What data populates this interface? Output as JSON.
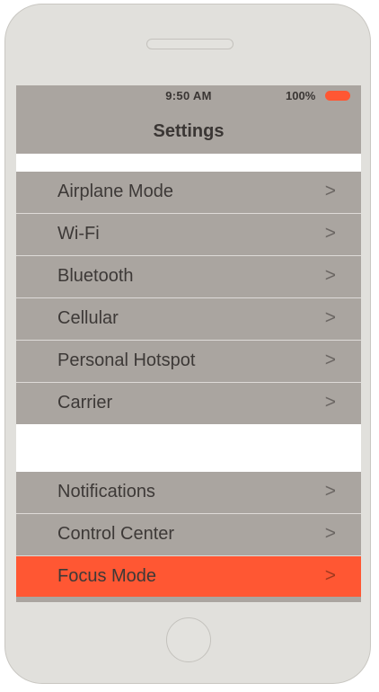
{
  "status_bar": {
    "time": "9:50 AM",
    "battery_percent": "100%",
    "battery_icon": "battery-full-icon",
    "battery_color": "#ff5733"
  },
  "nav": {
    "title": "Settings"
  },
  "groups": [
    {
      "items": [
        {
          "label": "Airplane Mode",
          "chevron": ">"
        },
        {
          "label": "Wi-Fi",
          "chevron": ">"
        },
        {
          "label": "Bluetooth",
          "chevron": ">"
        },
        {
          "label": "Cellular",
          "chevron": ">"
        },
        {
          "label": "Personal Hotspot",
          "chevron": ">"
        },
        {
          "label": "Carrier",
          "chevron": ">"
        }
      ]
    },
    {
      "items": [
        {
          "label": "Notifications",
          "chevron": ">"
        },
        {
          "label": "Control Center",
          "chevron": ">"
        },
        {
          "label": "Focus Mode",
          "chevron": ">",
          "highlighted": true
        }
      ]
    }
  ],
  "colors": {
    "row_background": "#aaa5a0",
    "highlight": "#ff5733",
    "device_body": "#e1e0dc"
  }
}
